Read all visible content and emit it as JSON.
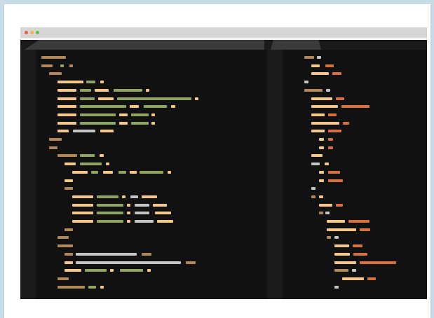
{
  "window": {
    "traffic_lights": {
      "close": "#f4584f",
      "minimize": "#f6b33e",
      "zoom": "#5ac04f"
    },
    "tabs": [
      {
        "label": ""
      },
      {
        "label": ""
      }
    ]
  },
  "colors": {
    "brown": "#b18658",
    "peach": "#f5c689",
    "green": "#8fa363",
    "grey": "#c4c4c4",
    "orange": "#d8703d",
    "background": "#111111",
    "gutter": "#1b1b1b"
  },
  "editor_left_lines": [
    [
      [
        8,
        43,
        "brown"
      ]
    ],
    [
      [
        8,
        24,
        "brown"
      ],
      [
        35,
        40,
        "green"
      ],
      [
        48,
        53,
        "brown"
      ]
    ],
    [
      [
        19,
        37,
        "brown"
      ]
    ],
    [
      [
        31,
        68,
        "peach"
      ],
      [
        72,
        85,
        "green"
      ],
      [
        92,
        97,
        "peach"
      ]
    ],
    [
      [
        31,
        58,
        "peach"
      ],
      [
        63,
        79,
        "green"
      ],
      [
        84,
        104,
        "peach"
      ],
      [
        111,
        152,
        "green"
      ],
      [
        157,
        162,
        "peach"
      ]
    ],
    [
      [
        31,
        58,
        "peach"
      ],
      [
        63,
        84,
        "green"
      ],
      [
        89,
        111,
        "peach"
      ],
      [
        116,
        222,
        "green"
      ],
      [
        227,
        232,
        "peach"
      ]
    ],
    [
      [
        31,
        58,
        "peach"
      ],
      [
        63,
        129,
        "green"
      ],
      [
        134,
        147,
        "peach"
      ],
      [
        154,
        187,
        "green"
      ],
      [
        193,
        199,
        "peach"
      ]
    ],
    [
      [
        31,
        58,
        "peach"
      ],
      [
        63,
        114,
        "green"
      ],
      [
        119,
        131,
        "peach"
      ],
      [
        136,
        161,
        "green"
      ],
      [
        165,
        170,
        "peach"
      ]
    ],
    [
      [
        31,
        58,
        "peach"
      ],
      [
        63,
        114,
        "green"
      ],
      [
        119,
        131,
        "peach"
      ],
      [
        136,
        161,
        "green"
      ],
      [
        165,
        170,
        "peach"
      ]
    ],
    [
      [
        31,
        47,
        "peach"
      ],
      [
        53,
        85,
        "grey"
      ],
      [
        92,
        111,
        "peach"
      ]
    ],
    [
      [
        19,
        37,
        "brown"
      ]
    ],
    [
      [
        19,
        31,
        "brown"
      ]
    ],
    [
      [
        31,
        59,
        "brown"
      ],
      [
        63,
        84,
        "green"
      ],
      [
        91,
        97,
        "peach"
      ]
    ],
    [
      [
        41,
        57,
        "peach"
      ],
      [
        63,
        94,
        "green"
      ],
      [
        100,
        105,
        "peach"
      ]
    ],
    [
      [
        52,
        74,
        "peach"
      ],
      [
        79,
        89,
        "green"
      ],
      [
        96,
        110,
        "peach"
      ],
      [
        118,
        129,
        "green"
      ],
      [
        134,
        144,
        "peach"
      ],
      [
        148,
        182,
        "green"
      ],
      [
        188,
        193,
        "peach"
      ]
    ],
    [
      [
        41,
        53,
        "peach"
      ]
    ],
    [
      [
        41,
        53,
        "brown"
      ]
    ],
    [
      [
        52,
        82,
        "peach"
      ],
      [
        87,
        118,
        "green"
      ],
      [
        123,
        128,
        "peach"
      ],
      [
        135,
        146,
        "grey"
      ],
      [
        151,
        173,
        "peach"
      ]
    ],
    [
      [
        52,
        82,
        "peach"
      ],
      [
        87,
        125,
        "green"
      ],
      [
        130,
        135,
        "peach"
      ],
      [
        141,
        162,
        "grey"
      ],
      [
        167,
        187,
        "peach"
      ]
    ],
    [
      [
        52,
        82,
        "peach"
      ],
      [
        87,
        125,
        "green"
      ],
      [
        130,
        135,
        "peach"
      ],
      [
        141,
        162,
        "grey"
      ],
      [
        170,
        193,
        "peach"
      ]
    ],
    [
      [
        52,
        82,
        "peach"
      ],
      [
        87,
        125,
        "green"
      ],
      [
        130,
        135,
        "peach"
      ],
      [
        141,
        168,
        "grey"
      ],
      [
        173,
        196,
        "peach"
      ]
    ],
    [
      [
        41,
        53,
        "brown"
      ]
    ],
    [
      [
        31,
        47,
        "brown"
      ]
    ],
    [
      [
        31,
        53,
        "brown"
      ]
    ],
    [
      [
        41,
        53,
        "brown"
      ],
      [
        57,
        144,
        "grey"
      ],
      [
        151,
        165,
        "brown"
      ]
    ],
    [
      [
        41,
        53,
        "peach"
      ],
      [
        57,
        207,
        "grey"
      ],
      [
        214,
        228,
        "brown"
      ]
    ],
    [
      [
        41,
        65,
        "peach"
      ],
      [
        70,
        101,
        "green"
      ],
      [
        106,
        111,
        "peach"
      ],
      [
        120,
        153,
        "green"
      ],
      [
        159,
        164,
        "peach"
      ]
    ],
    [
      [
        31,
        47,
        "brown"
      ]
    ],
    [
      [
        31,
        70,
        "brown"
      ],
      [
        75,
        86,
        "green"
      ],
      [
        92,
        97,
        "peach"
      ]
    ]
  ],
  "editor_right_lines": [
    [
      [
        31,
        45,
        "brown"
      ],
      [
        49,
        55,
        "grey"
      ]
    ],
    [
      [
        41,
        53,
        "peach"
      ],
      [
        61,
        73,
        "orange"
      ]
    ],
    [
      [
        41,
        66,
        "peach"
      ],
      [
        71,
        84,
        "orange"
      ]
    ],
    [
      [
        31,
        37,
        "grey"
      ]
    ],
    [
      [
        31,
        57,
        "brown"
      ],
      [
        62,
        68,
        "grey"
      ]
    ],
    [
      [
        41,
        71,
        "peach"
      ],
      [
        76,
        88,
        "orange"
      ]
    ],
    [
      [
        41,
        79,
        "peach"
      ],
      [
        84,
        124,
        "orange"
      ]
    ],
    [
      [
        41,
        60,
        "peach"
      ],
      [
        65,
        77,
        "orange"
      ]
    ],
    [
      [
        41,
        81,
        "peach"
      ],
      [
        86,
        95,
        "orange"
      ]
    ],
    [
      [
        41,
        60,
        "peach"
      ],
      [
        65,
        84,
        "orange"
      ]
    ],
    [
      [
        52,
        59,
        "peach"
      ],
      [
        65,
        72,
        "orange"
      ]
    ],
    [
      [
        52,
        59,
        "peach"
      ],
      [
        65,
        72,
        "orange"
      ]
    ],
    [
      [
        41,
        57,
        "peach"
      ]
    ],
    [
      [
        41,
        53,
        "grey"
      ],
      [
        60,
        66,
        "peach"
      ]
    ],
    [
      [
        52,
        59,
        "peach"
      ],
      [
        65,
        82,
        "orange"
      ]
    ],
    [
      [
        52,
        59,
        "peach"
      ],
      [
        65,
        86,
        "orange"
      ]
    ],
    [
      [
        41,
        47,
        "grey"
      ]
    ],
    [
      [
        41,
        47,
        "brown"
      ],
      [
        52,
        58,
        "peach"
      ]
    ],
    [
      [
        52,
        71,
        "peach"
      ],
      [
        76,
        86,
        "orange"
      ]
    ],
    [
      [
        52,
        58,
        "brown"
      ],
      [
        61,
        67,
        "grey"
      ]
    ],
    [
      [
        63,
        89,
        "peach"
      ],
      [
        94,
        124,
        "orange"
      ]
    ],
    [
      [
        63,
        105,
        "peach"
      ],
      [
        110,
        125,
        "orange"
      ]
    ],
    [
      [
        63,
        69,
        "brown"
      ],
      [
        74,
        80,
        "grey"
      ]
    ],
    [
      [
        74,
        95,
        "peach"
      ],
      [
        100,
        114,
        "orange"
      ]
    ],
    [
      [
        74,
        96,
        "peach"
      ],
      [
        101,
        121,
        "orange"
      ]
    ],
    [
      [
        74,
        105,
        "peach"
      ],
      [
        110,
        162,
        "orange"
      ]
    ],
    [
      [
        74,
        94,
        "brown"
      ],
      [
        99,
        105,
        "grey"
      ]
    ],
    [
      [
        85,
        116,
        "peach"
      ],
      [
        121,
        133,
        "orange"
      ]
    ],
    [
      [
        74,
        80,
        "grey"
      ]
    ]
  ]
}
